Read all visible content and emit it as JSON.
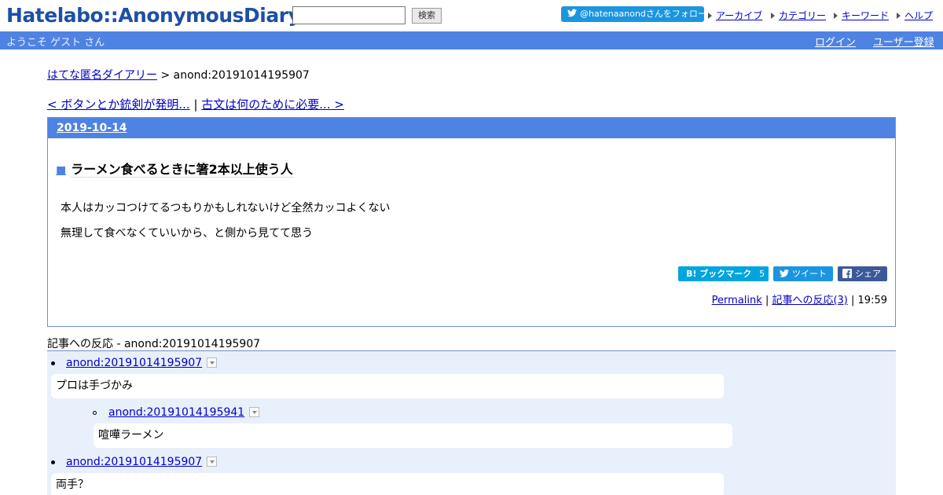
{
  "header": {
    "logo": "Hatelabo::AnonymousDiary",
    "search": {
      "value": "",
      "button_label": "検索"
    },
    "follow_label": "@hatenaanondさんをフォロー",
    "nav": [
      "アーカイブ",
      "カテゴリー",
      "キーワード",
      "ヘルプ"
    ]
  },
  "userbar": {
    "welcome": "ようこそ ゲスト さん",
    "login": "ログイン",
    "register": "ユーザー登録"
  },
  "breadcrumb": {
    "home": "はてな匿名ダイアリー",
    "separator": ">",
    "current": "anond:20191014195907"
  },
  "prevnext": {
    "prev": "< ボタンとか銃剣が発明...",
    "separator": "|",
    "next": "古文は何のために必要... >"
  },
  "entry": {
    "date": "2019-10-14",
    "marker": "■",
    "title": "ラーメン食べるときに箸2本以上使う人",
    "paragraphs": [
      "本人はカッコつけてるつもりかもしれないけど全然カッコよくない",
      "無理して食べなくていいから、と側から見てて思う"
    ],
    "share": {
      "bookmark_label": "B! ブックマーク",
      "bookmark_count": "5",
      "tweet_label": "ツイート",
      "facebook_label": "シェア"
    },
    "footer": {
      "permalink": "Permalink",
      "reactions_link": "記事への反応(3)",
      "time": "19:59"
    }
  },
  "reactions": {
    "heading": "記事への反応 - anond:20191014195907",
    "items": [
      {
        "id": "anond:20191014195907",
        "text": "プロは手づかみ"
      },
      {
        "id": "anond:20191014195941",
        "text": "喧嘩ラーメン"
      },
      {
        "id": "anond:20191014195907",
        "text": "両手？"
      }
    ]
  },
  "colors": {
    "accent": "#4e83e3",
    "logo": "#1d4fa6",
    "reaction_bg": "#e8f0fb",
    "bookmark": "#00a4de",
    "twitter": "#1b95e0",
    "facebook": "#3b5998"
  }
}
